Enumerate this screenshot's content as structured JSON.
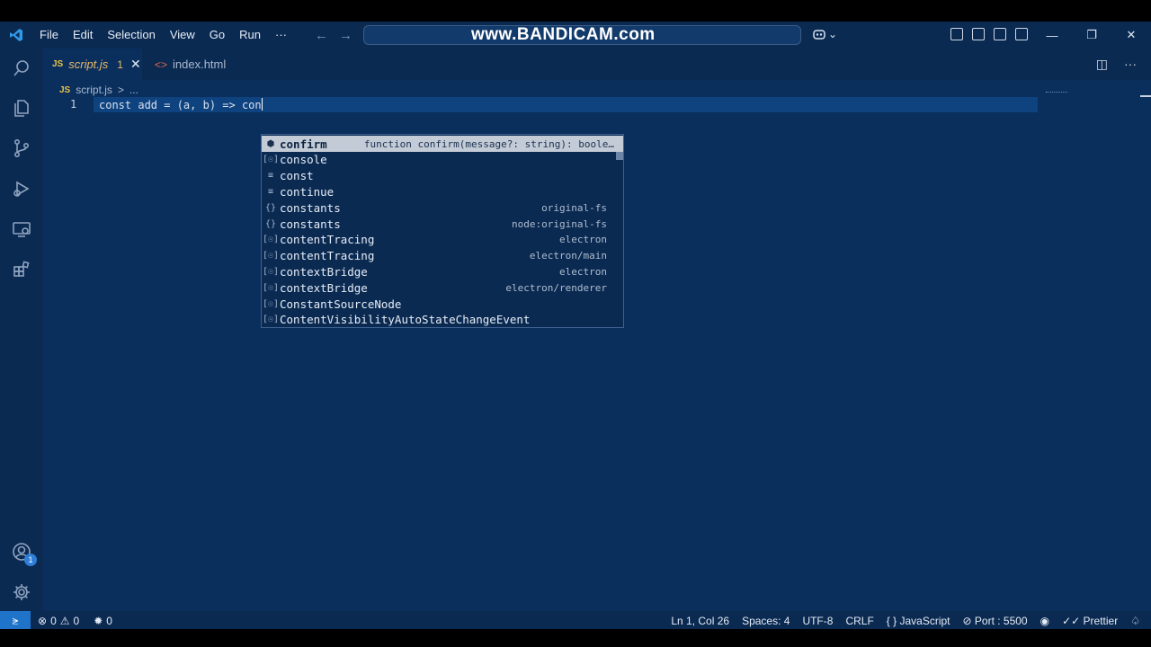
{
  "watermark": "www.BANDICAM.com",
  "menu": [
    "File",
    "Edit",
    "Selection",
    "View",
    "Go",
    "Run",
    "···"
  ],
  "tabs": [
    {
      "lang": "JS",
      "name": "script.js",
      "problems": "1",
      "active": true
    },
    {
      "name": "index.html",
      "active": false
    }
  ],
  "breadcrumb": {
    "lang": "JS",
    "file": "script.js",
    "sep": ">",
    "rest": "..."
  },
  "editor": {
    "line_number": "1",
    "code": "const add = (a, b) => con"
  },
  "suggestions": [
    {
      "icon": "method-icon",
      "glyph": "⬢",
      "label": "confirm",
      "detail": "function confirm(message?: string): boole…",
      "selected": true
    },
    {
      "icon": "variable-icon",
      "glyph": "[☉]",
      "label": "console",
      "detail": ""
    },
    {
      "icon": "keyword-icon",
      "glyph": "≡",
      "label": "const",
      "detail": ""
    },
    {
      "icon": "keyword-icon",
      "glyph": "≡",
      "label": "continue",
      "detail": ""
    },
    {
      "icon": "module-icon",
      "glyph": "{}",
      "label": "constants",
      "detail": "original-fs"
    },
    {
      "icon": "module-icon",
      "glyph": "{}",
      "label": "constants",
      "detail": "node:original-fs"
    },
    {
      "icon": "variable-icon",
      "glyph": "[☉]",
      "label": "contentTracing",
      "detail": "electron"
    },
    {
      "icon": "variable-icon",
      "glyph": "[☉]",
      "label": "contentTracing",
      "detail": "electron/main"
    },
    {
      "icon": "variable-icon",
      "glyph": "[☉]",
      "label": "contextBridge",
      "detail": "electron"
    },
    {
      "icon": "variable-icon",
      "glyph": "[☉]",
      "label": "contextBridge",
      "detail": "electron/renderer"
    },
    {
      "icon": "variable-icon",
      "glyph": "[☉]",
      "label": "ConstantSourceNode",
      "detail": ""
    },
    {
      "icon": "variable-icon",
      "glyph": "[☉]",
      "label": "ContentVisibilityAutoStateChangeEvent",
      "detail": ""
    }
  ],
  "status": {
    "errors": "0",
    "warnings": "0",
    "ports": "0",
    "position": "Ln 1, Col 26",
    "spaces": "Spaces: 4",
    "encoding": "UTF-8",
    "eol": "CRLF",
    "language": "JavaScript",
    "port": "Port : 5500",
    "formatter": "Prettier"
  },
  "accounts_badge": "1"
}
